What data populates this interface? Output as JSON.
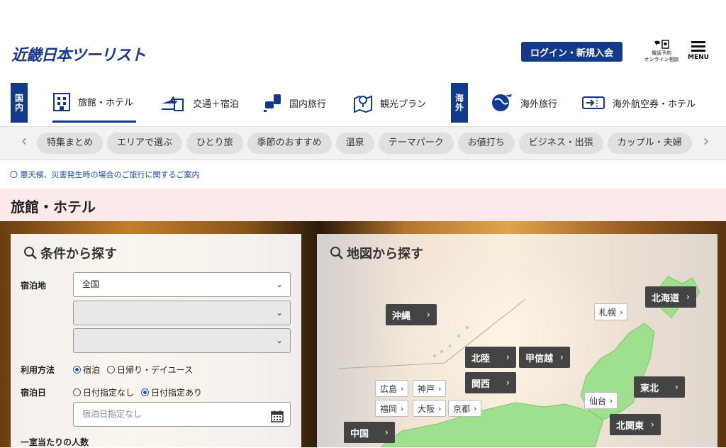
{
  "header": {
    "logo": "近畿日本ツーリスト",
    "login_label": "ログイン・新規入会",
    "tel_line1": "電話予約",
    "tel_line2": "オンライン相談",
    "menu_label": "MENU"
  },
  "categories": {
    "domestic_label": "国内",
    "overseas_label": "海外",
    "items": [
      {
        "label": "旅館・ホテル",
        "icon": "hotel-icon"
      },
      {
        "label": "交通＋宿泊",
        "icon": "plane-hotel-icon"
      },
      {
        "label": "国内旅行",
        "icon": "domestic-travel-icon"
      },
      {
        "label": "観光プラン",
        "icon": "map-pin-icon"
      },
      {
        "label": "海外旅行",
        "icon": "globe-plane-icon"
      },
      {
        "label": "海外航空券・ホテル",
        "icon": "ticket-icon"
      }
    ]
  },
  "tags": [
    "特集まとめ",
    "エリアで選ぶ",
    "ひとり旅",
    "季節のおすすめ",
    "温泉",
    "テーマパーク",
    "お値打ち",
    "ビジネス・出張",
    "カップル・夫婦"
  ],
  "notice": "〇 悪天候、災害発生時の場合のご旅行に関するご案内",
  "page_title": "旅館・ホテル",
  "search": {
    "title": "条件から探す",
    "destination_label": "宿泊地",
    "destination_value": "全国",
    "method_label": "利用方法",
    "method_options": [
      "宿泊",
      "日帰り・デイユース"
    ],
    "date_label": "宿泊日",
    "date_options": [
      "日付指定なし",
      "日付指定あり"
    ],
    "date_placeholder": "宿泊日指定なし",
    "guests_label": "一室当たりの人数"
  },
  "map": {
    "title": "地図から探す",
    "regions": [
      "沖縄",
      "北海道",
      "北陸",
      "甲信越",
      "関西",
      "東北",
      "中国",
      "北関東"
    ],
    "cities": [
      "札幌",
      "広島",
      "神戸",
      "福岡",
      "大阪",
      "京都",
      "仙台"
    ],
    "arrow": "›"
  },
  "colors": {
    "brand": "#123a8c",
    "tint": "#fde9ea",
    "map_land": "#9fe08f"
  }
}
